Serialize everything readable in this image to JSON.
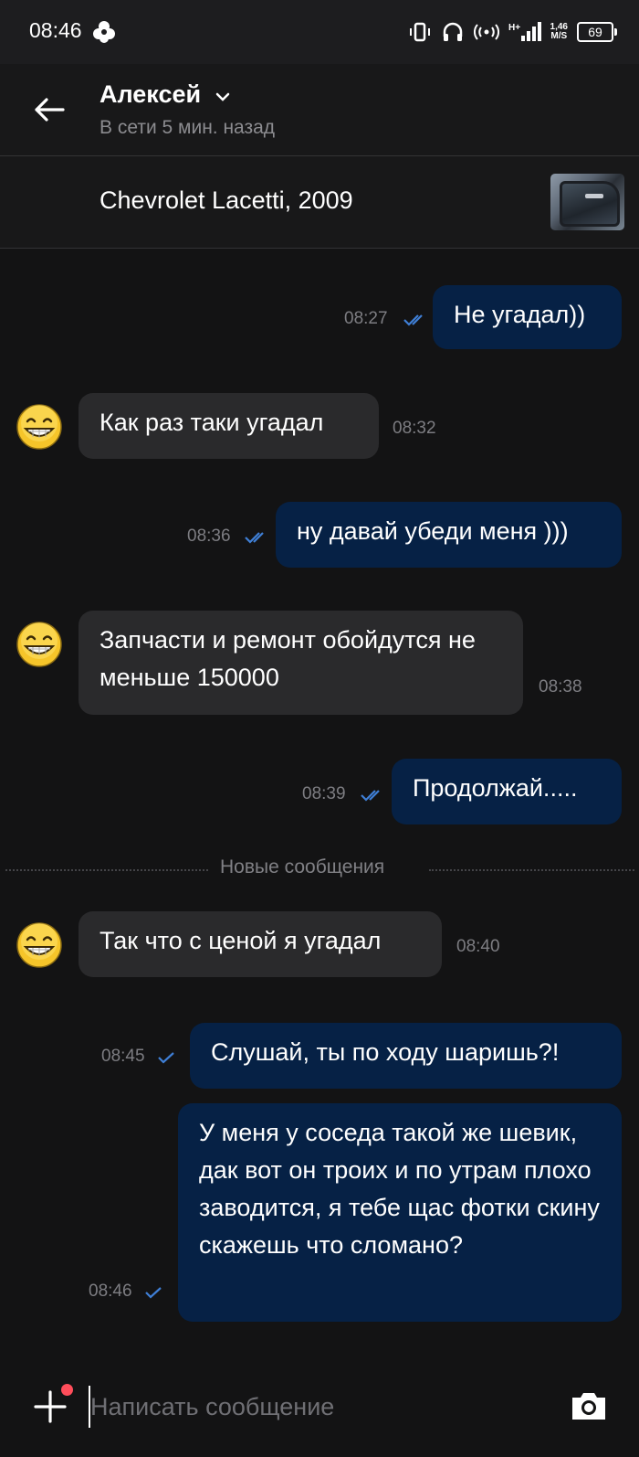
{
  "status_bar": {
    "time": "08:46",
    "network_speed": "1,46",
    "network_speed_unit": "M/S",
    "battery": "69"
  },
  "header": {
    "contact_name": "Алексей",
    "contact_status": "В сети 5 мин. назад"
  },
  "listing": {
    "title": "Chevrolet Lacetti, 2009"
  },
  "messages": [
    {
      "dir": "out",
      "text": "Не угадал))",
      "time": "08:27",
      "read": true
    },
    {
      "dir": "in",
      "text": "Как раз таки угадал",
      "time": "08:32"
    },
    {
      "dir": "out",
      "text": "ну давай убеди меня )))",
      "time": "08:36",
      "read": true
    },
    {
      "dir": "in",
      "text": "Запчасти и ремонт обойдутся не меньше 150000",
      "time": "08:38"
    },
    {
      "dir": "out",
      "text": "Продолжай.....",
      "time": "08:39",
      "read": true
    },
    {
      "dir": "in",
      "text": "Так что с ценой я угадал",
      "time": "08:40"
    },
    {
      "dir": "out",
      "text": "Слушай, ты по ходу шаришь?!",
      "time": "08:45",
      "read": false
    },
    {
      "dir": "out",
      "text": "У меня у соседа такой же шевик, дак вот он троих и по утрам плохо заводится, я тебе щас фотки скину скажешь что сломано?",
      "time": "08:46",
      "read": false
    }
  ],
  "new_messages_label": "Новые сообщения",
  "composer": {
    "placeholder": "Написать сообщение"
  },
  "colors": {
    "background": "#131314",
    "outgoing_bubble": "#062145",
    "incoming_bubble": "#2a2a2c",
    "tick": "#3f7fd6",
    "badge": "#ff4d5a"
  },
  "icons": [
    "back-arrow-icon",
    "chevron-down-icon",
    "smiley-avatar-icon",
    "double-check-icon",
    "single-check-icon",
    "plus-icon",
    "camera-icon"
  ]
}
